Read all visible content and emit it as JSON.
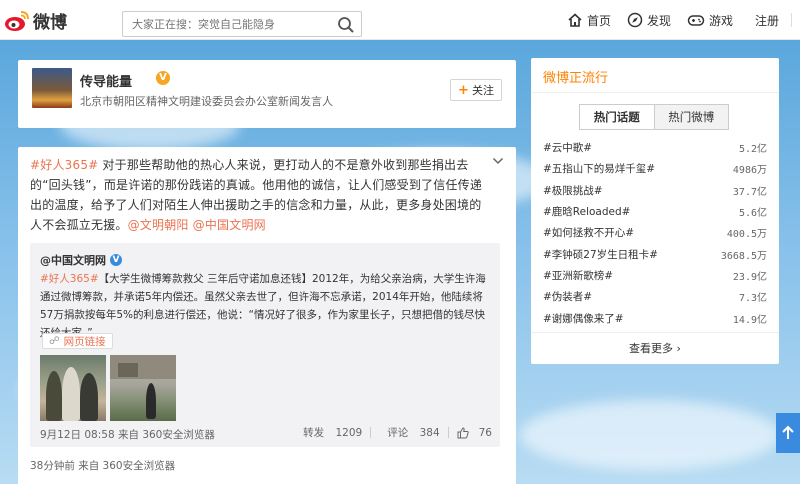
{
  "topbar": {
    "logo_text": "微博",
    "search_placeholder": "大家正在搜：突觉自己能隐身",
    "nav": [
      {
        "label": "首页",
        "icon": "home-icon"
      },
      {
        "label": "发现",
        "icon": "compass-icon"
      },
      {
        "label": "游戏",
        "icon": "gamepad-icon"
      },
      {
        "label": "注册",
        "icon": ""
      }
    ]
  },
  "profile": {
    "name": "传导能量",
    "verified": "V",
    "description": "北京市朝阳区精神文明建设委员会办公室新闻发言人",
    "follow_label": "关注"
  },
  "post": {
    "tag": "#好人365#",
    "text": " 对于那些帮助他的热心人来说，更打动人的不是意外收到那些捐出去的“回头钱”，而是许诺的那份践诺的真诚。他用他的诚信，让人们感受到了信任传递出的温度，给予了人们对陌生人伸出援助之手的信念和力量，从此，更多身处困境的人不会孤立无援。",
    "mention1": "@文明朝阳",
    "mention2": "@中国文明网",
    "repost": {
      "user": "@中国文明网",
      "tag": "#好人365#",
      "text": "【大学生微博筹款救父 三年后守诺加息还钱】2012年，为给父亲治病，大学生许海通过微博筹款，并承诺5年内偿还。虽然父亲去世了，但许海不忘承诺，2014年开始，他陆续将57万捐款按每年5%的利息进行偿还，他说：“情况好了很多，作为家里长子，只想把借的钱尽快还给大家。”",
      "link_label": "网页链接",
      "date": "9月12日 08:58",
      "source": "来自 360安全浏览器",
      "repost_label": "转发",
      "repost_count": "1209",
      "comment_label": "评论",
      "comment_count": "384",
      "like_count": "76"
    },
    "footer": "38分钟前 来自 360安全浏览器"
  },
  "trend": {
    "title": "微博正流行",
    "tabs": [
      "热门话题",
      "热门微博"
    ],
    "items": [
      {
        "topic": "#云中歌#",
        "count": "5.2亿"
      },
      {
        "topic": "#五指山下的易烊千玺#",
        "count": "4986万"
      },
      {
        "topic": "#极限挑战#",
        "count": "37.7亿"
      },
      {
        "topic": "#鹿晗Reloaded#",
        "count": "5.6亿"
      },
      {
        "topic": "#如何拯救不开心#",
        "count": "400.5万"
      },
      {
        "topic": "#李钟硕27岁生日租卡#",
        "count": "3668.5万"
      },
      {
        "topic": "#亚洲新歌榜#",
        "count": "23.9亿"
      },
      {
        "topic": "#伪装者#",
        "count": "7.3亿"
      },
      {
        "topic": "#谢娜偶像来了#",
        "count": "14.9亿"
      }
    ],
    "see_more": "查看更多"
  },
  "colors": {
    "accent": "#ff8200",
    "link": "#eb7350",
    "verified_blue": "#3a8be0"
  }
}
